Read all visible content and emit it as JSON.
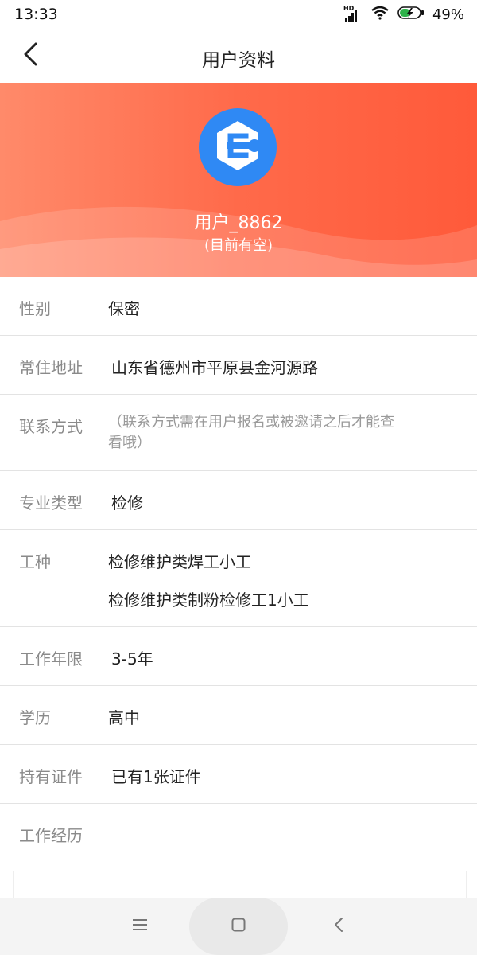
{
  "status_bar": {
    "time": "13:33",
    "network_label": "HD",
    "battery_percent": "49%"
  },
  "nav": {
    "title": "用户资料",
    "back_icon": "chevron-left-icon"
  },
  "profile": {
    "avatar_icon": "wrench-logo-icon",
    "name": "用户_8862",
    "availability": "(目前有空)",
    "colors": {
      "header_start": "#ff8a6a",
      "header_end": "#ff5a3a",
      "avatar_bg": "#2f89f4"
    }
  },
  "fields": {
    "gender": {
      "label": "性别",
      "value": "保密"
    },
    "address": {
      "label": "常住地址",
      "value": "山东省德州市平原县金河源路"
    },
    "contact": {
      "label": "联系方式",
      "value_line1": "（联系方式需在用户报名或被邀请之后才能查",
      "value_line2": "看哦）"
    },
    "specialty": {
      "label": "专业类型",
      "value": "检修"
    },
    "trade": {
      "label": "工种",
      "values": [
        "检修维护类焊工小工",
        "检修维护类制粉检修工1小工"
      ]
    },
    "years": {
      "label": "工作年限",
      "value": "3-5年"
    },
    "education": {
      "label": "学历",
      "value": "高中"
    },
    "certificates": {
      "label": "持有证件",
      "value": "已有1张证件"
    },
    "experience": {
      "label": "工作经历"
    }
  },
  "system_nav": {
    "menu_icon": "menu-icon",
    "home_icon": "home-square-icon",
    "back_icon": "back-triangle-icon"
  }
}
